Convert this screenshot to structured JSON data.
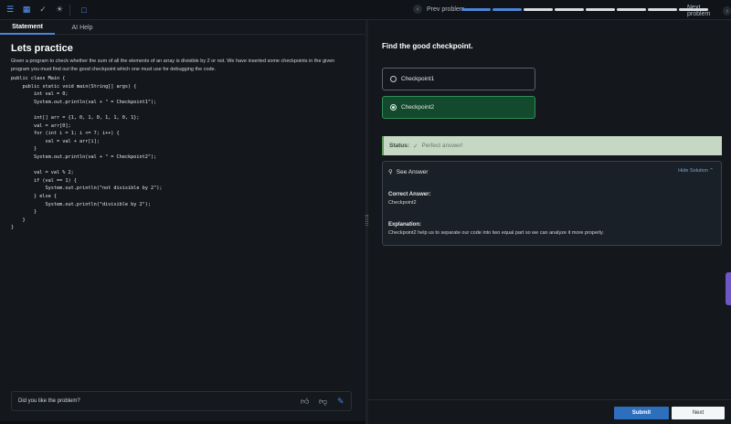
{
  "topbar": {
    "prev_label": "Prev problem",
    "next_label": "Next problem",
    "progress": {
      "total": 8,
      "completed": 2
    }
  },
  "tabs": [
    {
      "label": "Statement",
      "active": true
    },
    {
      "label": "AI Help",
      "active": false
    }
  ],
  "statement": {
    "title": "Lets practice",
    "description": "Given a program to check whether the sum of all the elements of an array is divisible by 2 or not. We have inserted some checkpoints in the given program you must find out the good checkpoint which one must use for debugging the code.",
    "code": "public class Main {\n    public static void main(String[] args) {\n        int val = 0;\n        System.out.println(val + \" = Checkpoint1\");\n\n        int[] arr = {1, 0, 1, 0, 1, 1, 0, 1};\n        val = arr[0];\n        for (int i = 1; i <= 7; i++) {\n            val = val + arr[i];\n        }\n        System.out.println(val + \" = Checkpoint2\");\n\n        val = val % 2;\n        if (val == 1) {\n            System.out.println(\"not divisible by 2\");\n        } else {\n            System.out.println(\"divisible by 2\");\n        }\n    }\n}",
    "feedback_question": "Did you like the problem?"
  },
  "question": {
    "title": "Find the good checkpoint.",
    "options": [
      {
        "label": "Checkpoint1",
        "selected": false
      },
      {
        "label": "Checkpoint2",
        "selected": true
      }
    ],
    "status_label": "Status:",
    "status_value": "Perfect answer!",
    "see_answer": "See Answer",
    "hide_solution": "Hide Solution",
    "correct_answer_label": "Correct Answer:",
    "correct_answer_value": "Checkpoint2",
    "explanation_label": "Explanation:",
    "explanation_value": "Checkpoint2 help us to separate our code into two equal part so we can analyze it more properly."
  },
  "footer": {
    "submit_label": "Submit",
    "next_label": "Next"
  },
  "colors": {
    "accent": "#4a86d8",
    "selected_option": "#13492c",
    "status_bg": "#c4d8c3"
  }
}
